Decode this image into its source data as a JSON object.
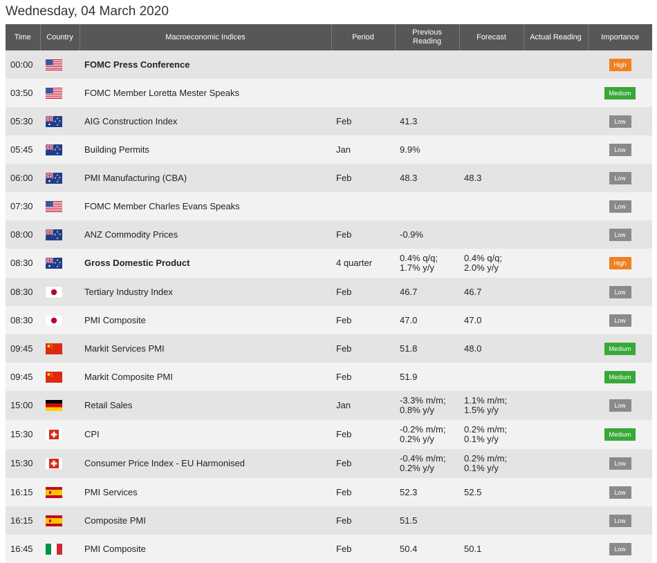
{
  "date_title": "Wednesday, 04 March 2020",
  "headers": {
    "time": "Time",
    "country": "Country",
    "indices": "Macroeconomic Indices",
    "period": "Period",
    "previous": "Previous Reading",
    "forecast": "Forecast",
    "actual": "Actual Reading",
    "importance": "Importance"
  },
  "importance_colors": {
    "High": "#f07f22",
    "Medium": "#38a838",
    "Low": "#8a8a8a"
  },
  "rows": [
    {
      "time": "00:00",
      "flag": "us-flag-icon",
      "event": "FOMC Press Conference",
      "bold": true,
      "period": "",
      "previous": "",
      "forecast": "",
      "actual": "",
      "importance": "High"
    },
    {
      "time": "03:50",
      "flag": "us-flag-icon",
      "event": "FOMC Member Loretta Mester Speaks",
      "bold": false,
      "period": "",
      "previous": "",
      "forecast": "",
      "actual": "",
      "importance": "Medium"
    },
    {
      "time": "05:30",
      "flag": "au-flag-icon",
      "event": "AIG Construction Index",
      "bold": false,
      "period": "Feb",
      "previous": "41.3",
      "forecast": "",
      "actual": "",
      "importance": "Low"
    },
    {
      "time": "05:45",
      "flag": "nz-flag-icon",
      "event": "Building Permits",
      "bold": false,
      "period": "Jan",
      "previous": "9.9%",
      "forecast": "",
      "actual": "",
      "importance": "Low"
    },
    {
      "time": "06:00",
      "flag": "au-flag-icon",
      "event": "PMI Manufacturing (CBA)",
      "bold": false,
      "period": "Feb",
      "previous": "48.3",
      "forecast": "48.3",
      "actual": "",
      "importance": "Low"
    },
    {
      "time": "07:30",
      "flag": "us-flag-icon",
      "event": "FOMC Member Charles Evans Speaks",
      "bold": false,
      "period": "",
      "previous": "",
      "forecast": "",
      "actual": "",
      "importance": "Low"
    },
    {
      "time": "08:00",
      "flag": "nz-flag-icon",
      "event": "ANZ Commodity Prices",
      "bold": false,
      "period": "Feb",
      "previous": "-0.9%",
      "forecast": "",
      "actual": "",
      "importance": "Low"
    },
    {
      "time": "08:30",
      "flag": "au-flag-icon",
      "event": "Gross Domestic Product",
      "bold": true,
      "period": "4 quarter",
      "previous": [
        "0.4% q/q;",
        "1.7% y/y"
      ],
      "forecast": [
        "0.4% q/q;",
        "2.0% y/y"
      ],
      "actual": "",
      "importance": "High"
    },
    {
      "time": "08:30",
      "flag": "jp-flag-icon",
      "event": "Tertiary Industry Index",
      "bold": false,
      "period": "Feb",
      "previous": "46.7",
      "forecast": "46.7",
      "actual": "",
      "importance": "Low"
    },
    {
      "time": "08:30",
      "flag": "jp-flag-icon",
      "event": "PMI Composite",
      "bold": false,
      "period": "Feb",
      "previous": "47.0",
      "forecast": "47.0",
      "actual": "",
      "importance": "Low"
    },
    {
      "time": "09:45",
      "flag": "cn-flag-icon",
      "event": "Markit Services PMI",
      "bold": false,
      "period": "Feb",
      "previous": "51.8",
      "forecast": "48.0",
      "actual": "",
      "importance": "Medium"
    },
    {
      "time": "09:45",
      "flag": "cn-flag-icon",
      "event": "Markit Composite PMI",
      "bold": false,
      "period": "Feb",
      "previous": "51.9",
      "forecast": "",
      "actual": "",
      "importance": "Medium"
    },
    {
      "time": "15:00",
      "flag": "de-flag-icon",
      "event": "Retail Sales",
      "bold": false,
      "period": "Jan",
      "previous": [
        "-3.3% m/m;",
        "0.8% y/y"
      ],
      "forecast": [
        "1.1% m/m;",
        "1.5% y/y"
      ],
      "actual": "",
      "importance": "Low"
    },
    {
      "time": "15:30",
      "flag": "ch-flag-icon",
      "event": "CPI",
      "bold": false,
      "period": "Feb",
      "previous": [
        "-0.2% m/m;",
        "0.2% y/y"
      ],
      "forecast": [
        "0.2% m/m;",
        "0.1% y/y"
      ],
      "actual": "",
      "importance": "Medium"
    },
    {
      "time": "15:30",
      "flag": "ch-flag-icon",
      "event": "Consumer Price Index - EU Harmonised",
      "bold": false,
      "period": "Feb",
      "previous": [
        "-0.4% m/m;",
        "0.2% y/y"
      ],
      "forecast": [
        "0.2% m/m;",
        "0.1% y/y"
      ],
      "actual": "",
      "importance": "Low"
    },
    {
      "time": "16:15",
      "flag": "es-flag-icon",
      "event": "PMI Services",
      "bold": false,
      "period": "Feb",
      "previous": "52.3",
      "forecast": "52.5",
      "actual": "",
      "importance": "Low"
    },
    {
      "time": "16:15",
      "flag": "es-flag-icon",
      "event": "Composite PMI",
      "bold": false,
      "period": "Feb",
      "previous": "51.5",
      "forecast": "",
      "actual": "",
      "importance": "Low"
    },
    {
      "time": "16:45",
      "flag": "it-flag-icon",
      "event": "PMI Composite",
      "bold": false,
      "period": "Feb",
      "previous": "50.4",
      "forecast": "50.1",
      "actual": "",
      "importance": "Low"
    }
  ]
}
